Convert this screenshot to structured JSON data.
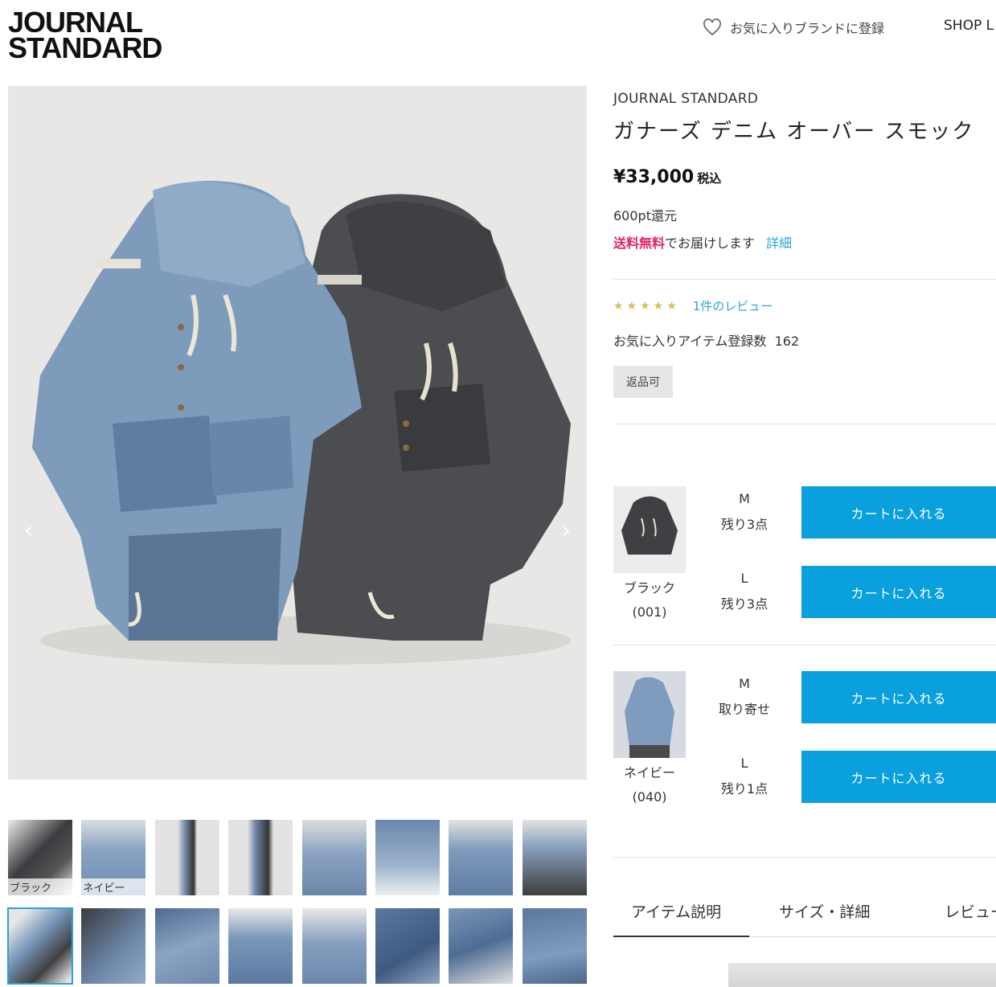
{
  "header": {
    "logo_line1": "JOURNAL",
    "logo_line2": "STANDARD",
    "favorite_brand_label": "お気に入りブランドに登録",
    "shop_link": "SHOP L"
  },
  "product": {
    "brand": "JOURNAL STANDARD",
    "title": "ガナーズ デニム オーバー スモック",
    "price": "¥33,000",
    "tax_label": "税込",
    "points": "600pt還元",
    "shipping_free": "送料無料",
    "shipping_rest": "でお届けします",
    "shipping_detail": "詳細",
    "rating_stars": "★★★★★",
    "review_link": "1件のレビュー",
    "favorite_count_label": "お気に入りアイテム登録数",
    "favorite_count": "162",
    "return_badge": "返品可"
  },
  "gallery": {
    "thumb_labels": [
      "ブラック",
      "ネイビー"
    ],
    "thumb_count": 16,
    "selected_index": 8
  },
  "variants": [
    {
      "color": "ブラック",
      "code": "(001)",
      "sizes": [
        {
          "size": "M",
          "stock": "残り3点",
          "button": "カートに入れる"
        },
        {
          "size": "L",
          "stock": "残り3点",
          "button": "カートに入れる"
        }
      ]
    },
    {
      "color": "ネイビー",
      "code": "(040)",
      "sizes": [
        {
          "size": "M",
          "stock": "取り寄せ",
          "button": "カートに入れる"
        },
        {
          "size": "L",
          "stock": "残り1点",
          "button": "カートに入れる"
        }
      ]
    }
  ],
  "tabs": [
    "アイテム説明",
    "サイズ・詳細",
    "レビュー"
  ],
  "colors": {
    "accent": "#0a9fdd",
    "link": "#2aa3d6",
    "free_shipping": "#e0246a",
    "star": "#d8bd5a"
  }
}
